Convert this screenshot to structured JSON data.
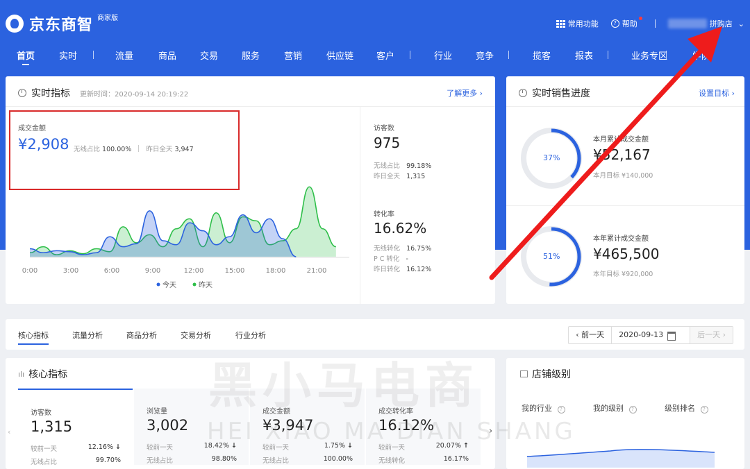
{
  "app": {
    "logo_text": "京东商智",
    "badge": "商家版"
  },
  "topbar": {
    "common_functions": "常用功能",
    "help": "帮助",
    "shop_suffix": "拼购店"
  },
  "nav": [
    "首页",
    "实时",
    "流量",
    "商品",
    "交易",
    "服务",
    "营销",
    "供应链",
    "客户",
    "行业",
    "竞争",
    "揽客",
    "报表",
    "业务专区",
    "学院"
  ],
  "realtime": {
    "title": "实时指标",
    "updated": "更新时间：2020-09-14 20:19:22",
    "more_link": "了解更多 ›",
    "gmv": {
      "label": "成交金额",
      "value": "¥2,908",
      "wireless_label": "无线占比",
      "wireless_value": "100.00%",
      "yesterday_label": "昨日全天",
      "yesterday_value": "3,947"
    },
    "visitors": {
      "label": "访客数",
      "value": "975",
      "rows": [
        {
          "label": "无线占比",
          "value": "99.18%"
        },
        {
          "label": "昨日全天",
          "value": "1,315"
        }
      ]
    },
    "conversion": {
      "label": "转化率",
      "value": "16.62%",
      "rows": [
        {
          "label": "无线转化",
          "value": "16.75%"
        },
        {
          "label": "P C 转化",
          "value": "-"
        },
        {
          "label": "昨日转化",
          "value": "16.12%"
        }
      ]
    }
  },
  "progress": {
    "title": "实时销售进度",
    "link": "设置目标 ›",
    "month": {
      "label": "本月累计成交金额",
      "value": "¥52,167",
      "target": "本月目标 ¥140,000",
      "percent": 37,
      "percent_text": "37%"
    },
    "year": {
      "label": "本年累计成交金额",
      "value": "¥465,500",
      "target": "本年目标 ¥920,000",
      "percent": 51,
      "percent_text": "51%"
    }
  },
  "tabs": {
    "items": [
      "核心指标",
      "流量分析",
      "商品分析",
      "交易分析",
      "行业分析"
    ],
    "prev_day": "‹ 前一天",
    "date": "2020-09-13",
    "next_day": "后一天 ›"
  },
  "core": {
    "title": "核心指标",
    "metrics": [
      {
        "label": "访客数",
        "value": "1,315",
        "cmp_label": "较前一天",
        "cmp_value": "12.16%",
        "dir": "↓",
        "wl_label": "无线占比",
        "wl_value": "99.70%"
      },
      {
        "label": "浏览量",
        "value": "3,002",
        "cmp_label": "较前一天",
        "cmp_value": "18.42%",
        "dir": "↓",
        "wl_label": "无线占比",
        "wl_value": "98.80%"
      },
      {
        "label": "成交金额",
        "value": "¥3,947",
        "cmp_label": "较前一天",
        "cmp_value": "1.75%",
        "dir": "↓",
        "wl_label": "无线占比",
        "wl_value": "100.00%"
      },
      {
        "label": "成交转化率",
        "value": "16.12%",
        "cmp_label": "较前一天",
        "cmp_value": "20.07%",
        "dir": "↑",
        "wl_label": "无线转化",
        "wl_value": "16.17%"
      }
    ]
  },
  "shop_level": {
    "title": "店铺级别",
    "cols": [
      "我的行业",
      "我的级别",
      "级别排名"
    ]
  },
  "watermark": {
    "main": "黑小马电商",
    "sub": "HEI XIAO MA DIAN SHANG"
  },
  "chart_data": {
    "type": "area",
    "categories": [
      "0:00",
      "3:00",
      "6:00",
      "9:00",
      "12:00",
      "15:00",
      "18:00",
      "21:00"
    ],
    "series": [
      {
        "name": "今天",
        "color": "#2b62df",
        "x": [
          0,
          1,
          2,
          3,
          4,
          5,
          6,
          7,
          8,
          9,
          10,
          11,
          12,
          13,
          14,
          15,
          16,
          17,
          18,
          19,
          20
        ],
        "y": [
          8,
          4,
          6,
          5,
          2,
          4,
          20,
          10,
          13,
          46,
          16,
          12,
          34,
          26,
          12,
          20,
          42,
          24,
          38,
          18,
          0
        ]
      },
      {
        "name": "昨天",
        "color": "#2fbf4a",
        "x": [
          0,
          1,
          2,
          3,
          4,
          5,
          6,
          7,
          8,
          9,
          10,
          11,
          12,
          13,
          14,
          15,
          16,
          17,
          18,
          19,
          20,
          21,
          22,
          23
        ],
        "y": [
          4,
          10,
          2,
          6,
          3,
          8,
          5,
          30,
          14,
          22,
          10,
          28,
          38,
          10,
          44,
          14,
          40,
          36,
          12,
          16,
          28,
          70,
          28,
          10
        ]
      }
    ],
    "xlim": [
      0,
      24
    ],
    "ylim": [
      0,
      80
    ],
    "legend": [
      "今天",
      "昨天"
    ]
  }
}
